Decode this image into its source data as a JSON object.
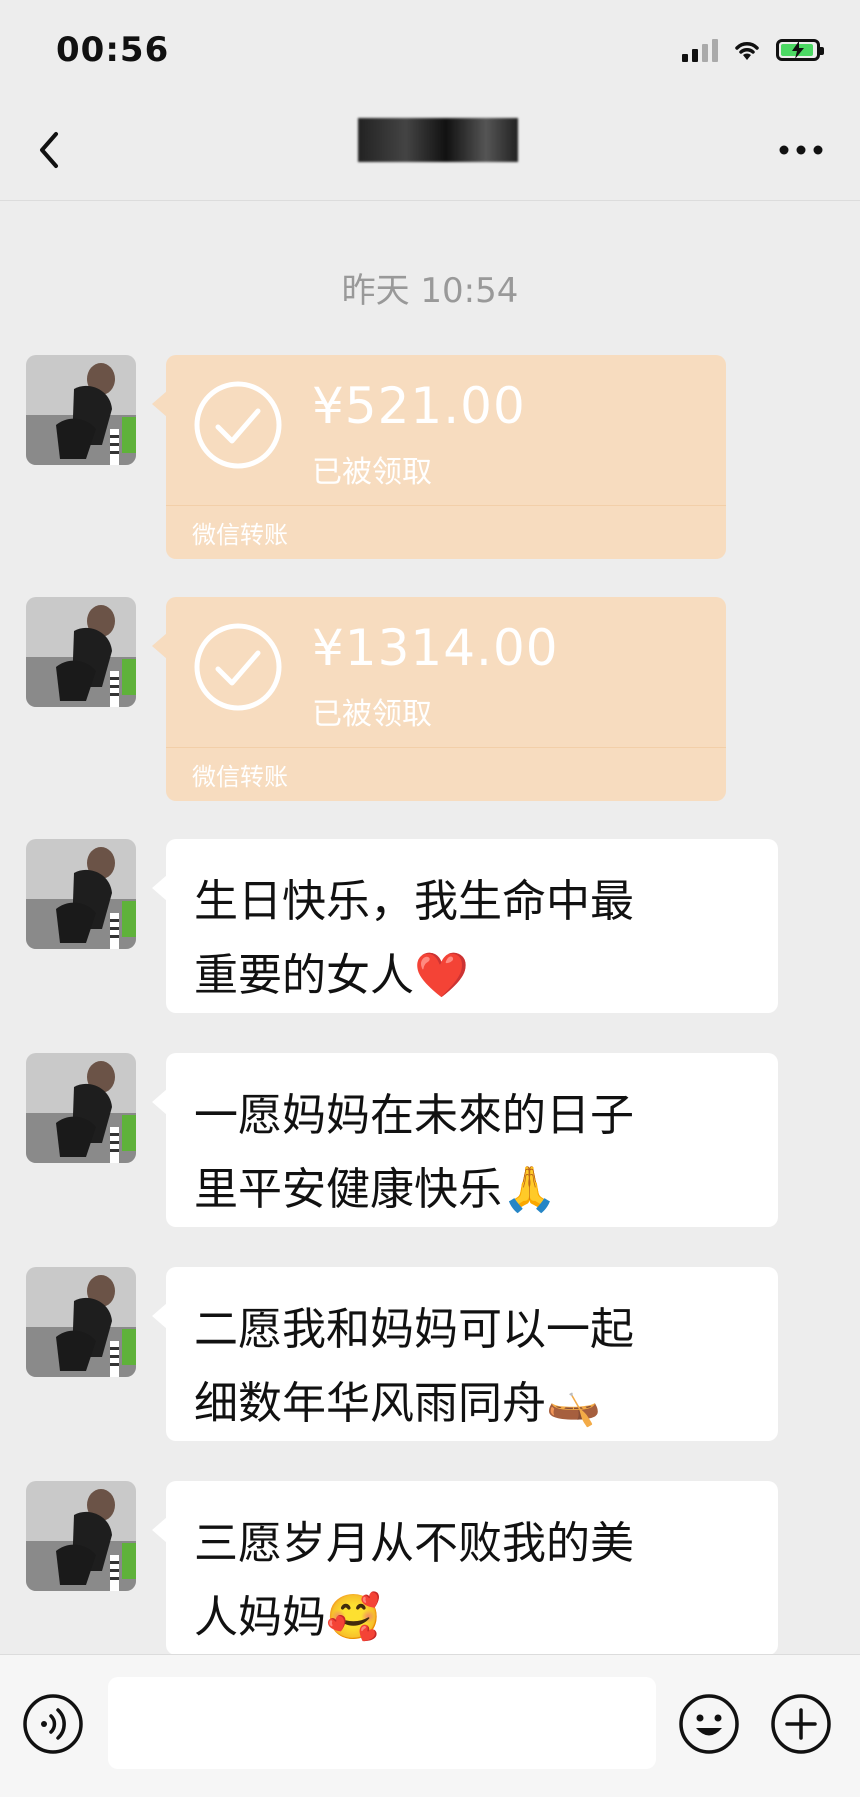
{
  "status_bar": {
    "time": "00:56",
    "battery_color": "#4cd964"
  },
  "nav": {
    "back_icon": "chevron-left-icon",
    "title_redacted": true,
    "more_icon": "more-dots-icon"
  },
  "chat": {
    "timestamp": "昨天 10:54",
    "transfers": [
      {
        "amount": "¥521.00",
        "status": "已被领取",
        "brand": "微信转账"
      },
      {
        "amount": "¥1314.00",
        "status": "已被领取",
        "brand": "微信转账"
      }
    ],
    "messages": [
      {
        "line1": "生日快乐，我生命中最",
        "line2": "重要的女人",
        "emoji": "❤️"
      },
      {
        "line1": "一愿妈妈在未來的日子",
        "line2": "里平安健康快乐",
        "emoji": "🙏"
      },
      {
        "line1": "二愿我和妈妈可以一起",
        "line2": "细数年华风雨同舟",
        "emoji": "🛶"
      },
      {
        "line1": "三愿岁月从不败我的美",
        "line2": "人妈妈",
        "emoji": "🥰"
      }
    ]
  },
  "input_bar": {
    "placeholder": ""
  },
  "colors": {
    "transfer_bg": "#f7dcbf",
    "chat_bg": "#ededed"
  }
}
